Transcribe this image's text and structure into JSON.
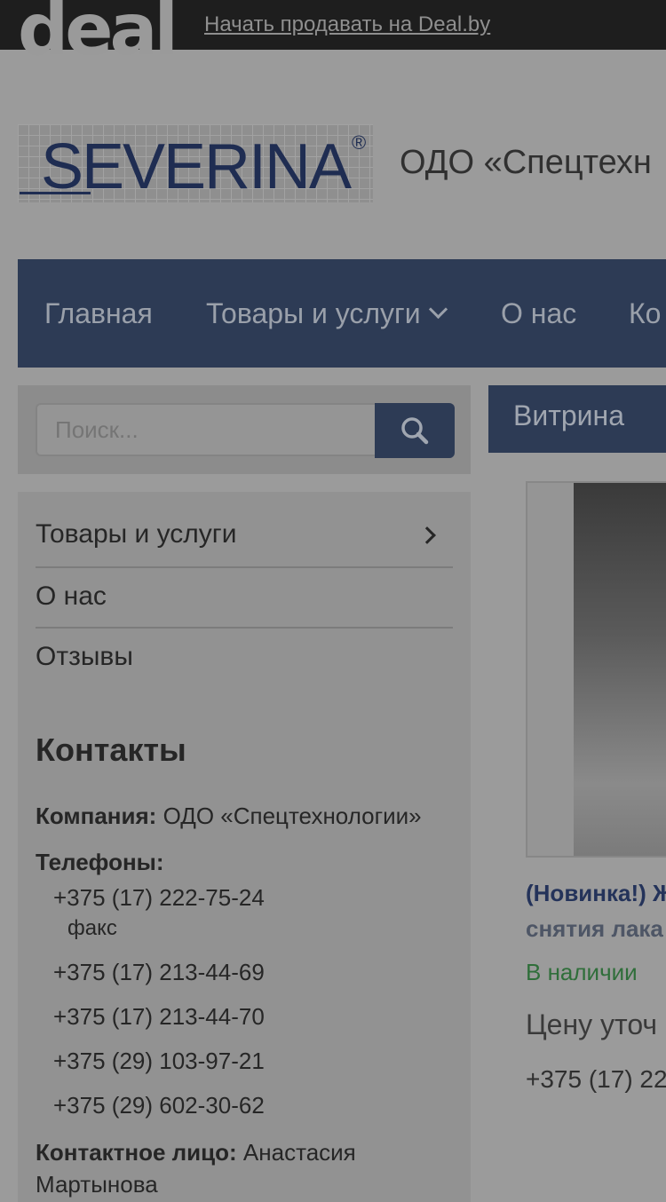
{
  "topbar": {
    "logo": "deal",
    "sell_link": "Начать продавать на Deal.by"
  },
  "brand": {
    "logo_text": "SEVERINA",
    "logo_reg": "®",
    "company_name": "ОДО «Спецтехн"
  },
  "nav": {
    "items": [
      {
        "label": "Главная"
      },
      {
        "label": "Товары и услуги"
      },
      {
        "label": "О нас"
      },
      {
        "label": "Ко"
      }
    ]
  },
  "search": {
    "placeholder": "Поиск..."
  },
  "sidebar": {
    "items": [
      {
        "label": "Товары и услуги"
      },
      {
        "label": "О нас"
      },
      {
        "label": "Отзывы"
      }
    ]
  },
  "contacts": {
    "heading": "Контакты",
    "company_label": "Компания:",
    "company_value": "ОДО «Спецтехнологии»",
    "phones_label": "Телефоны:",
    "phones": [
      "+375 (17) 222-75-24",
      "+375 (17) 213-44-69",
      "+375 (17) 213-44-70",
      "+375 (29) 103-97-21",
      "+375 (29) 602-30-62"
    ],
    "fax_note": "факс",
    "person_label": "Контактное лицо:",
    "person_value": "Анастасия Мартынова"
  },
  "showcase": {
    "tab": "Витрина",
    "product_title": "(Новинка!) Ж",
    "product_subtitle": "снятия лака",
    "stock": "В наличии",
    "price": "Цену уточ",
    "phone": "+375 (17) 22"
  }
}
